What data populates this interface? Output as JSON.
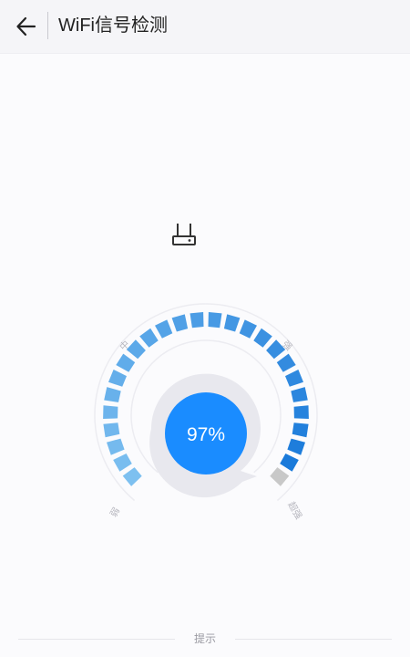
{
  "header": {
    "title": "WiFi信号检测",
    "back_icon": "arrow-left-icon"
  },
  "router": {
    "icon": "router-icon"
  },
  "gauge": {
    "signal_percent": 97,
    "value_label": "97%",
    "scale_labels": {
      "weak": "弱",
      "medium": "中",
      "strong": "强",
      "excellent": "超强"
    },
    "colors": {
      "accent": "#1a8cff",
      "segment_light": "#7dc0f0",
      "segment_dark": "#1677d9",
      "segment_inactive": "#c8c8c8"
    }
  },
  "footer": {
    "tip_label": "提示"
  }
}
